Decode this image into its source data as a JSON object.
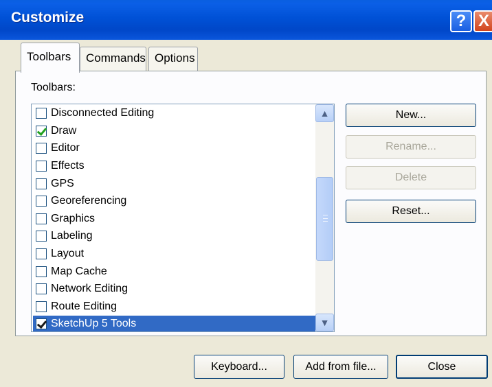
{
  "window": {
    "title": "Customize",
    "help_glyph": "?",
    "close_glyph": "X"
  },
  "tabs": [
    {
      "label": "Toolbars",
      "active": true
    },
    {
      "label": "Commands",
      "active": false
    },
    {
      "label": "Options",
      "active": false
    }
  ],
  "toolbars_section": {
    "label": "Toolbars:",
    "items": [
      {
        "label": "Disconnected Editing",
        "checked": false,
        "selected": false
      },
      {
        "label": "Draw",
        "checked": true,
        "selected": false
      },
      {
        "label": "Editor",
        "checked": false,
        "selected": false
      },
      {
        "label": "Effects",
        "checked": false,
        "selected": false
      },
      {
        "label": "GPS",
        "checked": false,
        "selected": false
      },
      {
        "label": "Georeferencing",
        "checked": false,
        "selected": false
      },
      {
        "label": "Graphics",
        "checked": false,
        "selected": false
      },
      {
        "label": "Labeling",
        "checked": false,
        "selected": false
      },
      {
        "label": "Layout",
        "checked": false,
        "selected": false
      },
      {
        "label": "Map Cache",
        "checked": false,
        "selected": false
      },
      {
        "label": "Network Editing",
        "checked": false,
        "selected": false
      },
      {
        "label": "Route Editing",
        "checked": false,
        "selected": false
      },
      {
        "label": "SketchUp 5 Tools",
        "checked": true,
        "selected": true
      }
    ],
    "scroll_position_fraction": 0.5
  },
  "side_buttons": [
    {
      "label": "New...",
      "enabled": true
    },
    {
      "label": "Rename...",
      "enabled": false
    },
    {
      "label": "Delete",
      "enabled": false
    },
    {
      "label": "Reset...",
      "enabled": true
    }
  ],
  "bottom_buttons": [
    {
      "label": "Keyboard..."
    },
    {
      "label": "Add from file..."
    },
    {
      "label": "Close"
    }
  ],
  "colors": {
    "title_bar": "#0054e3",
    "selection": "#316ac5",
    "dialog_bg": "#ece9d8"
  }
}
